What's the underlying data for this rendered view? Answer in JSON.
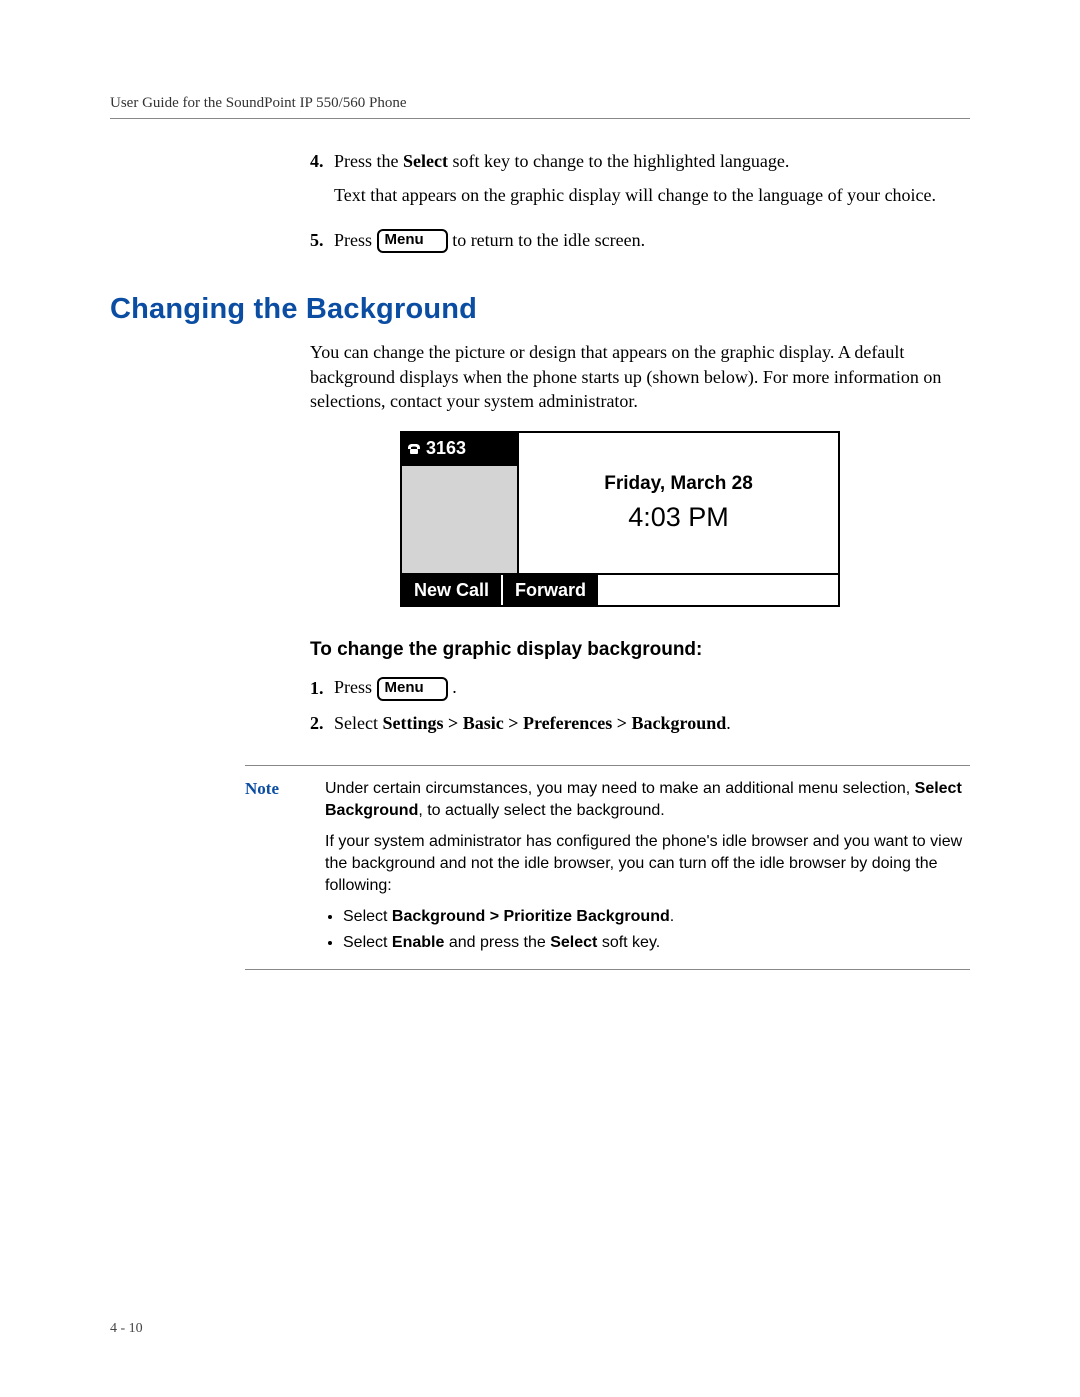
{
  "header": {
    "title": "User Guide for the SoundPoint IP 550/560 Phone"
  },
  "steps_top": {
    "s4": {
      "num": "4.",
      "line1a": "Press the ",
      "line1b": "Select",
      "line1c": " soft key to change to the highlighted language.",
      "line2": "Text that appears on the graphic display will change to the language of your choice."
    },
    "s5": {
      "num": "5.",
      "pre": "Press  ",
      "key": "Menu",
      "post": "  to return to the idle screen."
    }
  },
  "section": {
    "heading": "Changing the Background"
  },
  "intro": "You can change the picture or design that appears on the graphic display. A default background displays when the phone starts up (shown below). For more information on selections, contact your system administrator.",
  "display": {
    "ext": "3163",
    "date": "Friday, March 28",
    "time": "4:03 PM",
    "softkeys": {
      "new_call": "New Call",
      "forward": "Forward"
    }
  },
  "subhead": "To change the graphic display background:",
  "steps_bottom": {
    "s1": {
      "num": "1.",
      "pre": "Press  ",
      "key": "Menu",
      "post": "  ."
    },
    "s2": {
      "num": "2.",
      "a": "Select ",
      "b": "Settings > Basic > Preferences > Background",
      "c": "."
    }
  },
  "note": {
    "label": "Note",
    "p1a": "Under certain circumstances, you may need to make an additional menu selection, ",
    "p1b": "Select Background",
    "p1c": ", to actually select the background.",
    "p2": "If your system administrator has configured the phone's idle browser and you want to view the background and not the idle browser, you can turn off the idle browser by doing the following:",
    "b1a": "Select ",
    "b1b": "Background > Prioritize Background",
    "b1c": ".",
    "b2a": "Select ",
    "b2b": "Enable",
    "b2c": " and press the ",
    "b2d": "Select",
    "b2e": " soft key."
  },
  "pagenum": "4 - 10"
}
